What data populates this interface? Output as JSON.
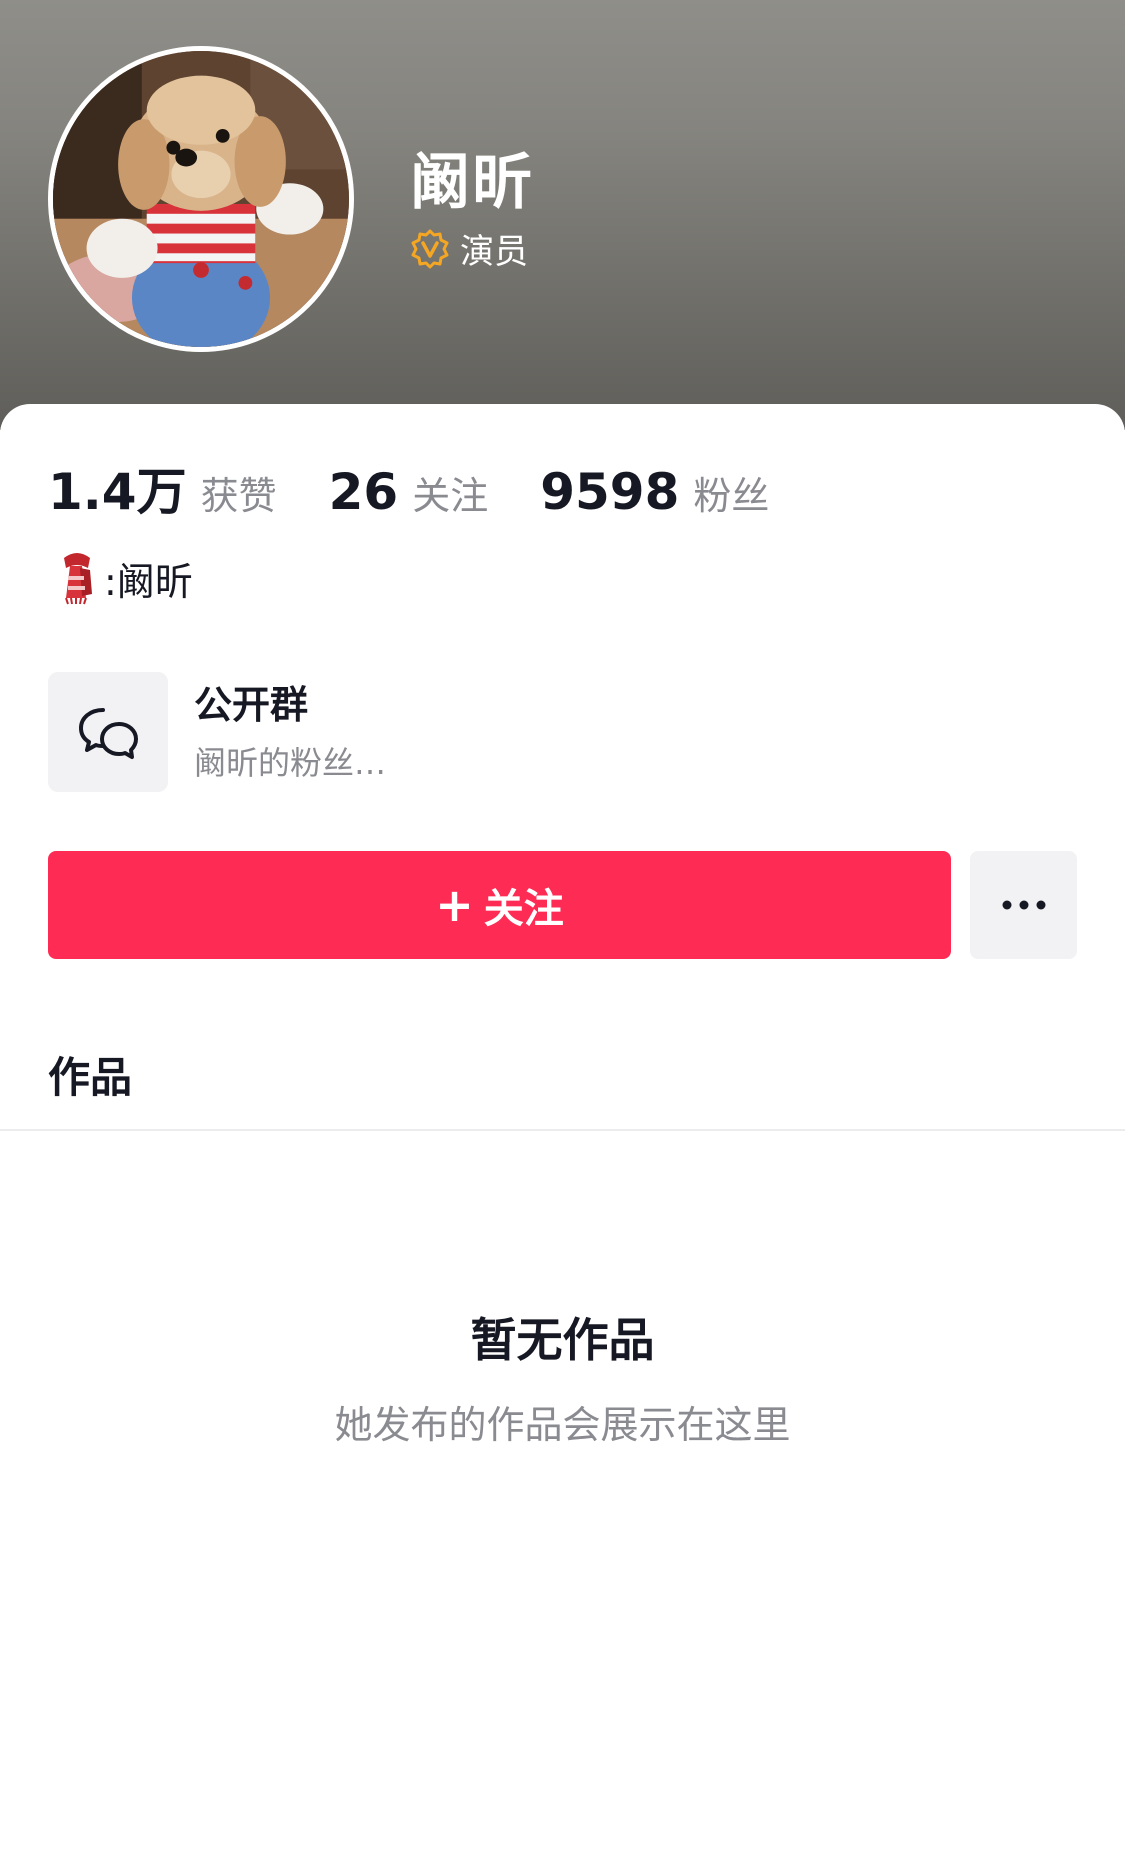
{
  "profile": {
    "name": "阚昕",
    "verification": "演员",
    "bio": ":阚昕",
    "bio_emoji": "scarf-emoji"
  },
  "stats": [
    {
      "value": "1.4万",
      "label": "获赞"
    },
    {
      "value": "26",
      "label": "关注"
    },
    {
      "value": "9598",
      "label": "粉丝"
    }
  ],
  "group": {
    "title": "公开群",
    "subtitle": "阚昕的粉丝…",
    "icon": "chat-bubbles-icon"
  },
  "actions": {
    "follow_plus": "+",
    "follow_label": "关注",
    "more_icon": "more-dots-icon"
  },
  "tabs": {
    "works": "作品"
  },
  "empty_state": {
    "title": "暂无作品",
    "subtitle": "她发布的作品会展示在这里"
  },
  "colors": {
    "accent": "#fe2c55",
    "verify_badge": "#f5a623",
    "text_primary": "#161823",
    "text_secondary": "#8a8b91"
  }
}
